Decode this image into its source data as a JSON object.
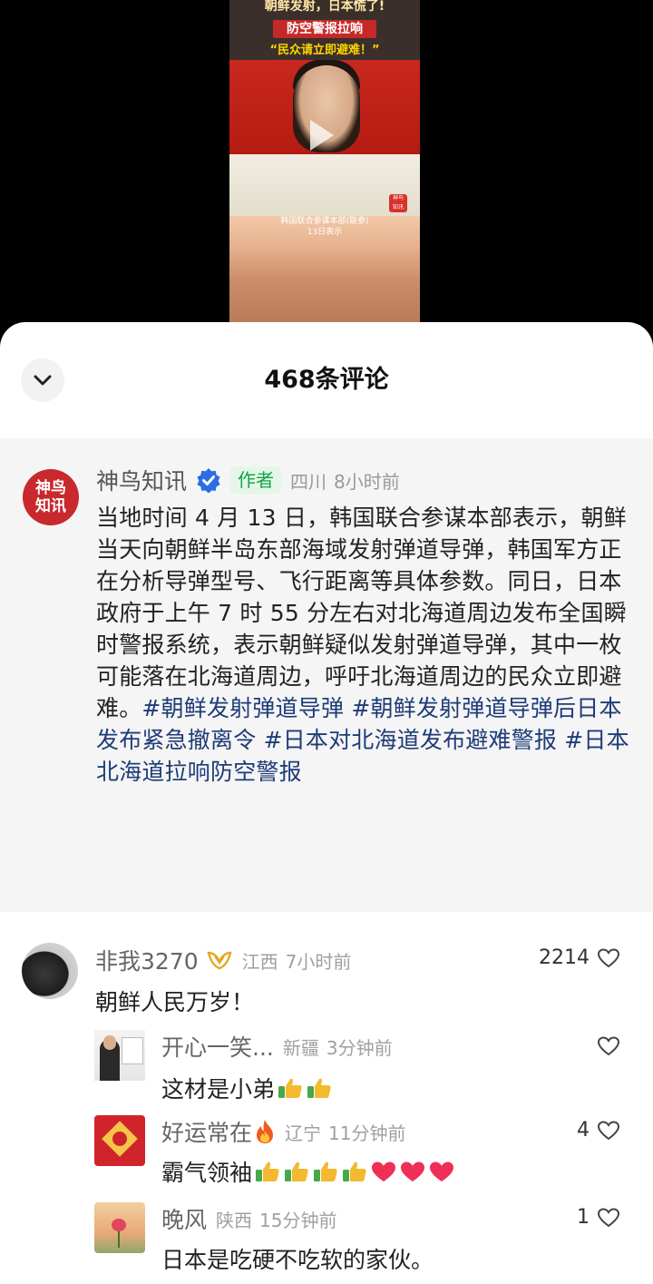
{
  "video": {
    "caption_top": "朝鲜发射，日本慌了!",
    "caption_alert": "防空警报拉响",
    "caption_quote": "“民众请立即避难！”",
    "caption_bottom_1": "韩国联合参谋本部(联参)",
    "caption_bottom_2": "13日表示",
    "logo_line1": "神鸟",
    "logo_line2": "知讯"
  },
  "sheet": {
    "title": "468条评论"
  },
  "author_post": {
    "avatar_line1": "神鸟",
    "avatar_line2": "知讯",
    "name": "神鸟知讯",
    "author_tag": "作者",
    "location": "四川",
    "time": "8小时前",
    "body": "当地时间 4 月 13 日，韩国联合参谋本部表示，朝鲜当天向朝鲜半岛东部海域发射弹道导弹，韩国军方正在分析导弹型号、飞行距离等具体参数。同日，日本政府于上午 7 时 55 分左右对北海道周边发布全国瞬时警报系统，表示朝鲜疑似发射弹道导弹，其中一枚可能落在北海道周边，呼吁北海道周边的民众立即避难。",
    "hashtags": [
      "#朝鲜发射弹道导弹",
      "#朝鲜发射弹道导弹后日本发布紧急撤离令",
      "#日本对北海道发布避难警报",
      "#日本北海道拉响防空警报"
    ]
  },
  "comments": [
    {
      "name": "非我3270",
      "location": "江西",
      "time": "7小时前",
      "text": "朝鲜人民万岁！",
      "likes": "2214"
    },
    {
      "name": "开心一笑...",
      "location": "新疆",
      "time": "3分钟前",
      "text": "这材是小弟",
      "likes": ""
    },
    {
      "name": "好运常在",
      "location": "辽宁",
      "time": "11分钟前",
      "text": "霸气领袖",
      "likes": "4"
    },
    {
      "name": "晚风",
      "location": "陕西",
      "time": "15分钟前",
      "text": "日本是吃硬不吃软的家伙。",
      "likes": "1"
    }
  ],
  "icons": {
    "collapse": "chevron-down-icon",
    "verified": "verified-badge-icon",
    "like": "heart-outline-icon",
    "thumbs": "thumbs-up-emoji",
    "heart_emoji": "red-heart-emoji",
    "fire": "fire-emoji",
    "badge": "gold-badge-icon"
  },
  "colors": {
    "verified": "#2b6de5",
    "author_tag_bg": "#e4f6e8",
    "author_tag_text": "#14a34a",
    "hashtag": "#1e3c78",
    "post_bg": "#f5f5f5"
  }
}
